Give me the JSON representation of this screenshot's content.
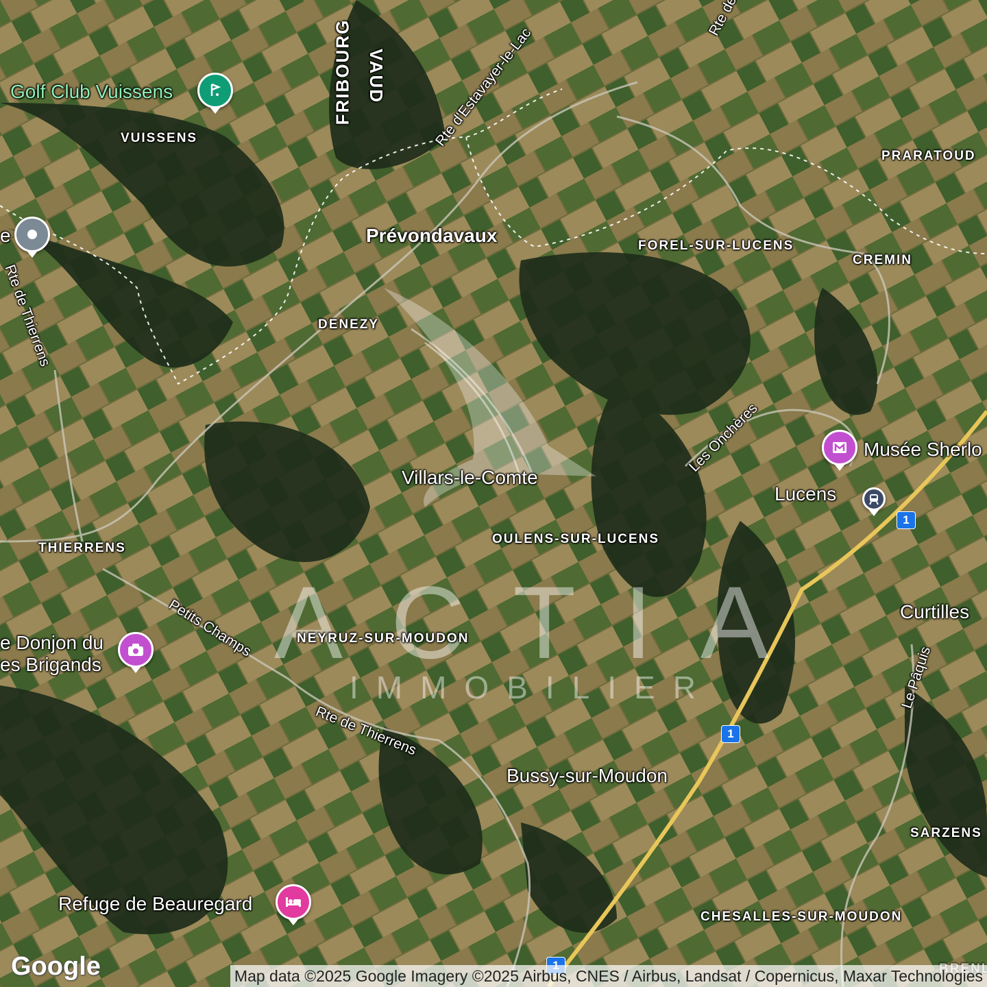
{
  "map": {
    "type": "satellite",
    "copyright": "Map data ©2025 Google Imagery ©2025 Airbus, CNES / Airbus, Landsat / Copernicus, Maxar Technologies",
    "provider_logo": "Google"
  },
  "watermark": {
    "brand": "ACTIA",
    "tagline": "IMMOBILIER",
    "emblem": "wing-logo-icon"
  },
  "towns": {
    "prevondavaux": "Prévondavaux",
    "villars": "Villars-le-Comte",
    "lucens": "Lucens",
    "curtilles": "Curtilles",
    "bussy": "Bussy-sur-Moudon"
  },
  "villages": {
    "vuissens": "VUISSENS",
    "denezy": "DENEZY",
    "thierrens": "THIERRENS",
    "forel": "FOREL-SUR-LUCENS",
    "praratoud": "PRARATOUD",
    "cremin": "CREMIN",
    "oulens": "OULENS-SUR-LUCENS",
    "neyruz": "NEYRUZ-SUR-MOUDON",
    "sarzens": "SARZENS",
    "chesalles": "CHESALLES-SUR-MOUDON",
    "brenles": "BRENLES"
  },
  "cantons": {
    "fribourg": "FRIBOURG",
    "vaud": "VAUD"
  },
  "roads": {
    "estavayer": "Rte d'Estavayer-le-Lac",
    "rte_de": "Rte de",
    "thierrens_left": "Rte de Thierrens",
    "thierrens_bottom": "Rte de Thierrens",
    "petits_champs": "Petits Champs",
    "oncheres": "Les Onchères",
    "paquis": "Le Pâquis",
    "highway": "1"
  },
  "pois": {
    "golf": {
      "name": "Golf Club Vuissens",
      "icon": "golf-icon",
      "color": "#0f9d75"
    },
    "donjon": {
      "line1": "e Donjon du",
      "line2": "es Brigands",
      "icon": "camera-icon",
      "color": "#c24fd0"
    },
    "musee": {
      "name": "Musée Sherlo",
      "icon": "museum-icon",
      "color": "#c24fd0"
    },
    "refuge": {
      "name": "Refuge de Beauregard",
      "icon": "bed-icon",
      "color": "#e23a9e"
    },
    "grey_place": {
      "name": "e",
      "icon": "place-icon",
      "color": "#7b8a95"
    },
    "station": {
      "icon": "train-icon",
      "color": "#3c4a66"
    }
  }
}
